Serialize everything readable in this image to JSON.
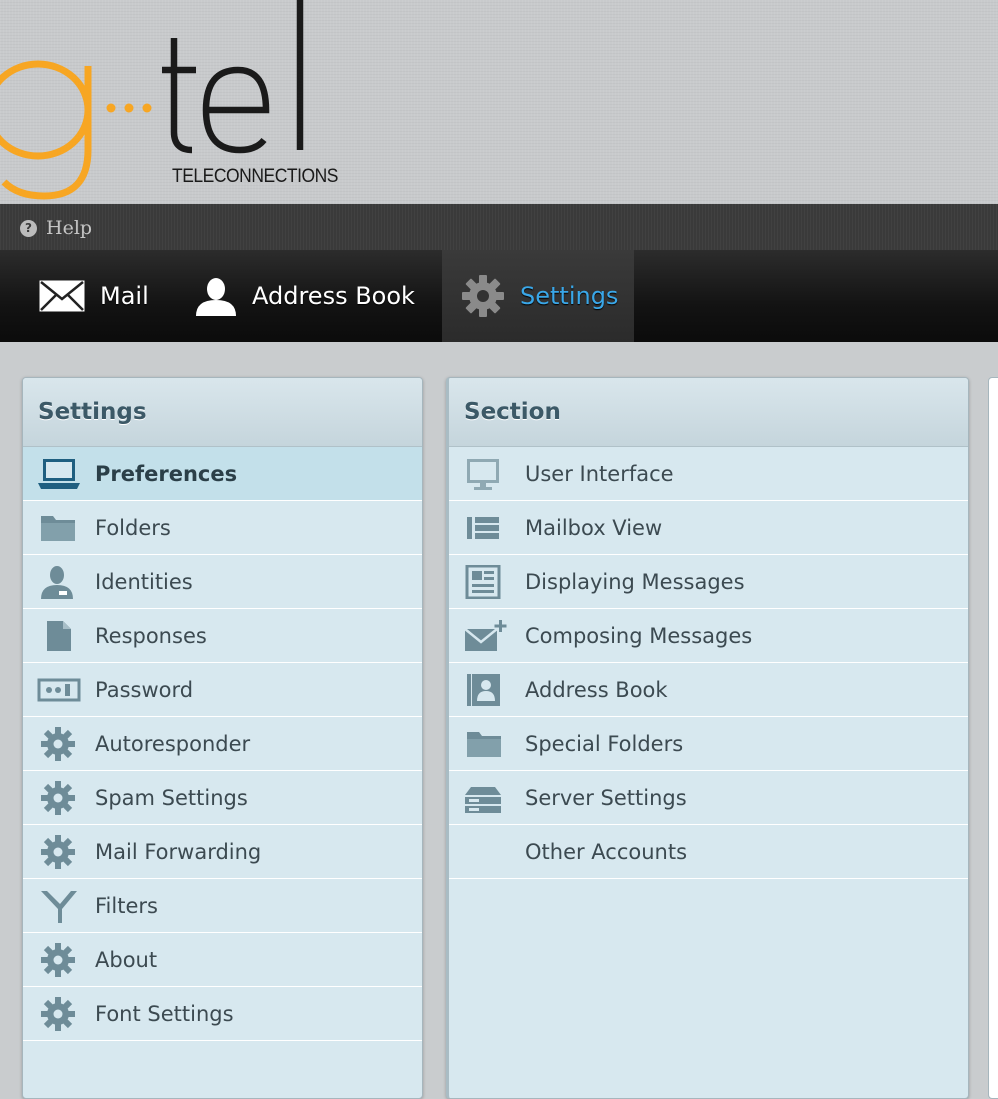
{
  "header": {
    "logo_text_g": "g",
    "logo_text_tel": "tel",
    "logo_subtitle": "TELECONNECTIONS"
  },
  "helpbar": {
    "help_label": "Help"
  },
  "nav": {
    "items": [
      {
        "label": "Mail",
        "icon": "envelope-icon"
      },
      {
        "label": "Address Book",
        "icon": "person-icon"
      },
      {
        "label": "Settings",
        "icon": "gear-icon",
        "active": true
      }
    ]
  },
  "settings_panel": {
    "title": "Settings",
    "items": [
      {
        "label": "Preferences",
        "icon": "laptop-icon",
        "selected": true
      },
      {
        "label": "Folders",
        "icon": "folder-icon"
      },
      {
        "label": "Identities",
        "icon": "person-icon"
      },
      {
        "label": "Responses",
        "icon": "document-icon"
      },
      {
        "label": "Password",
        "icon": "password-icon"
      },
      {
        "label": "Autoresponder",
        "icon": "gear-icon"
      },
      {
        "label": "Spam Settings",
        "icon": "gear-icon"
      },
      {
        "label": "Mail Forwarding",
        "icon": "gear-icon"
      },
      {
        "label": "Filters",
        "icon": "filter-icon"
      },
      {
        "label": "About",
        "icon": "gear-icon"
      },
      {
        "label": "Font Settings",
        "icon": "gear-icon"
      }
    ]
  },
  "section_panel": {
    "title": "Section",
    "items": [
      {
        "label": "User Interface",
        "icon": "monitor-icon"
      },
      {
        "label": "Mailbox View",
        "icon": "list-icon"
      },
      {
        "label": "Displaying Messages",
        "icon": "message-view-icon"
      },
      {
        "label": "Composing Messages",
        "icon": "compose-icon"
      },
      {
        "label": "Address Book",
        "icon": "contact-card-icon"
      },
      {
        "label": "Special Folders",
        "icon": "folder-icon"
      },
      {
        "label": "Server Settings",
        "icon": "server-icon"
      },
      {
        "label": "Other Accounts",
        "icon": ""
      }
    ]
  },
  "colors": {
    "accent": "#3aa7e8",
    "logo_orange": "#f7a623",
    "panel_bg": "#d7e8ef",
    "icon_color": "#6e8c98"
  }
}
